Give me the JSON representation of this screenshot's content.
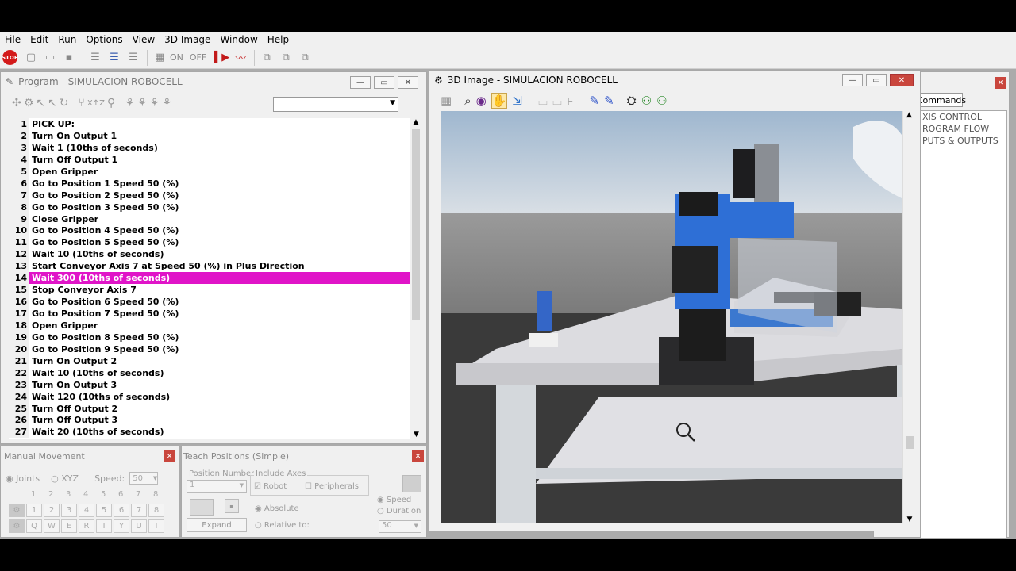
{
  "menu": [
    "File",
    "Edit",
    "Run",
    "Options",
    "View",
    "3D Image",
    "Window",
    "Help"
  ],
  "toolbar": {
    "stop_label": "STOP",
    "on_label": "ON",
    "off_label": "OFF"
  },
  "program_window": {
    "title": "Program -  SIMULACION ROBOCELL",
    "lines": [
      {
        "n": "1",
        "t": "PICK UP:"
      },
      {
        "n": "2",
        "t": "Turn On Output 1"
      },
      {
        "n": "3",
        "t": "Wait 1 (10ths of seconds)"
      },
      {
        "n": "4",
        "t": "Turn Off Output 1"
      },
      {
        "n": "5",
        "t": "Open Gripper"
      },
      {
        "n": "6",
        "t": "Go to Position 1 Speed 50 (%)"
      },
      {
        "n": "7",
        "t": "Go to Position 2 Speed 50 (%)"
      },
      {
        "n": "8",
        "t": "Go to Position 3 Speed 50 (%)"
      },
      {
        "n": "9",
        "t": "Close Gripper"
      },
      {
        "n": "10",
        "t": "Go to Position 4 Speed 50 (%)"
      },
      {
        "n": "11",
        "t": "Go to Position 5 Speed 50 (%)"
      },
      {
        "n": "12",
        "t": "Wait 10 (10ths of seconds)"
      },
      {
        "n": "13",
        "t": "Start Conveyor Axis 7 at Speed 50 (%) in Plus Direction"
      },
      {
        "n": "14",
        "t": "Wait 300 (10ths of seconds)"
      },
      {
        "n": "15",
        "t": "Stop Conveyor Axis 7"
      },
      {
        "n": "16",
        "t": "Go to Position 6 Speed 50 (%)"
      },
      {
        "n": "17",
        "t": "Go to Position 7 Speed 50 (%)"
      },
      {
        "n": "18",
        "t": "Open Gripper"
      },
      {
        "n": "19",
        "t": "Go to Position 8 Speed 50 (%)"
      },
      {
        "n": "20",
        "t": "Go to Position 9 Speed 50 (%)"
      },
      {
        "n": "21",
        "t": "Turn On Output 2"
      },
      {
        "n": "22",
        "t": "Wait 10 (10ths of seconds)"
      },
      {
        "n": "23",
        "t": "Turn On Output 3"
      },
      {
        "n": "24",
        "t": "Wait 120 (10ths of seconds)"
      },
      {
        "n": "25",
        "t": "Turn Off Output 2"
      },
      {
        "n": "26",
        "t": "Turn Off Output 3"
      },
      {
        "n": "27",
        "t": "Wait 20 (10ths of seconds)"
      }
    ],
    "selected_line": "14"
  },
  "image_window": {
    "title": "3D Image -  SIMULACION ROBOCELL"
  },
  "commands_window": {
    "tab": "Commands",
    "items": [
      "XIS CONTROL",
      "ROGRAM FLOW",
      "PUTS & OUTPUTS"
    ]
  },
  "manual_movement": {
    "title": "Manual Movement",
    "mode_joints": "Joints",
    "mode_xyz": "XYZ",
    "speed_label": "Speed:",
    "speed_value": "50",
    "numbers": [
      "1",
      "2",
      "3",
      "4",
      "5",
      "6",
      "7",
      "8"
    ],
    "letters": [
      "Q",
      "W",
      "E",
      "R",
      "T",
      "Y",
      "U",
      "I"
    ]
  },
  "teach_positions": {
    "title": "Teach Positions (Simple)",
    "position_number_label": "Position Number",
    "position_number_value": "1",
    "include_axes_label": "Include Axes",
    "robot_label": "Robot",
    "peripherals_label": "Peripherals",
    "expand_label": "Expand",
    "absolute_label": "Absolute",
    "relative_label": "Relative to:",
    "speed_label": "Speed",
    "duration_label": "Duration",
    "speed_value": "50"
  }
}
